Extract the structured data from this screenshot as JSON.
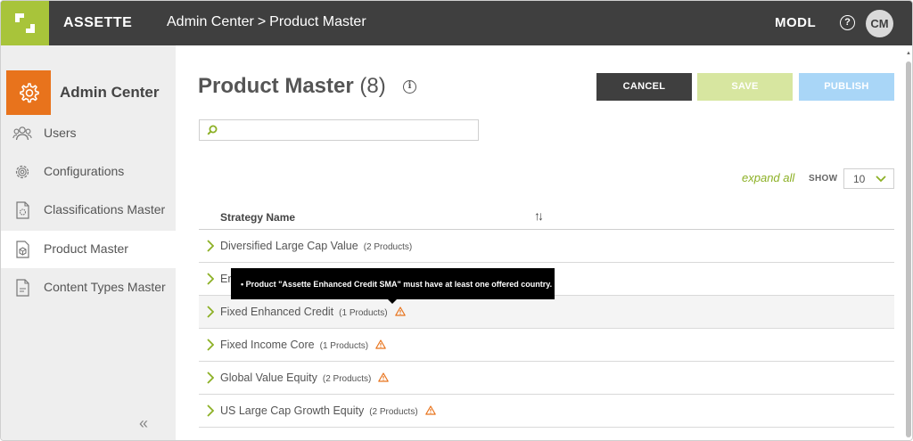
{
  "topbar": {
    "brand": "ASSETTE",
    "breadcrumb_parent": "Admin Center",
    "breadcrumb_sep": ">",
    "breadcrumb_current": "Product Master",
    "workspace": "MODL",
    "help": "?",
    "avatar": "CM"
  },
  "sidebar": {
    "title": "Admin Center",
    "items": [
      {
        "label": "Users",
        "icon": "users-icon"
      },
      {
        "label": "Configurations",
        "icon": "gear-icon"
      },
      {
        "label": "Classifications Master",
        "icon": "classification-doc-icon"
      },
      {
        "label": "Product Master",
        "icon": "product-box-icon",
        "active": true
      },
      {
        "label": "Content Types Master",
        "icon": "content-doc-icon"
      }
    ],
    "collapse": "«"
  },
  "main": {
    "title": "Product Master",
    "count": "(8)",
    "info": "i",
    "buttons": {
      "cancel": "CANCEL",
      "save": "SAVE",
      "publish": "PUBLISH"
    },
    "search_placeholder": "",
    "expand_all": "expand all",
    "show_label": "SHOW",
    "show_value": "10",
    "column_header": "Strategy Name",
    "sort_icon": "↑↓",
    "rows": [
      {
        "name": "Diversified Large Cap Value",
        "count": "(2 Products)",
        "warning": false
      },
      {
        "name": "En",
        "count": "",
        "warning": false
      },
      {
        "name": "Fixed Enhanced Credit",
        "count": "(1 Products)",
        "warning": true
      },
      {
        "name": "Fixed Income Core",
        "count": "(1 Products)",
        "warning": true
      },
      {
        "name": "Global Value Equity",
        "count": "(2 Products)",
        "warning": true
      },
      {
        "name": "US Large Cap Growth Equity",
        "count": "(2 Products)",
        "warning": true
      }
    ],
    "tooltip": "• Product \"Assette Enhanced Credit SMA\" must have at least one offered country."
  },
  "colors": {
    "topbar": "#3f3f3f",
    "logo_green": "#a8c43a",
    "admin_orange": "#e8731c",
    "accent_green": "#8cb025",
    "save_disabled": "#d7e6a0",
    "publish_disabled": "#a9d6f7",
    "warning": "#e8731c"
  }
}
